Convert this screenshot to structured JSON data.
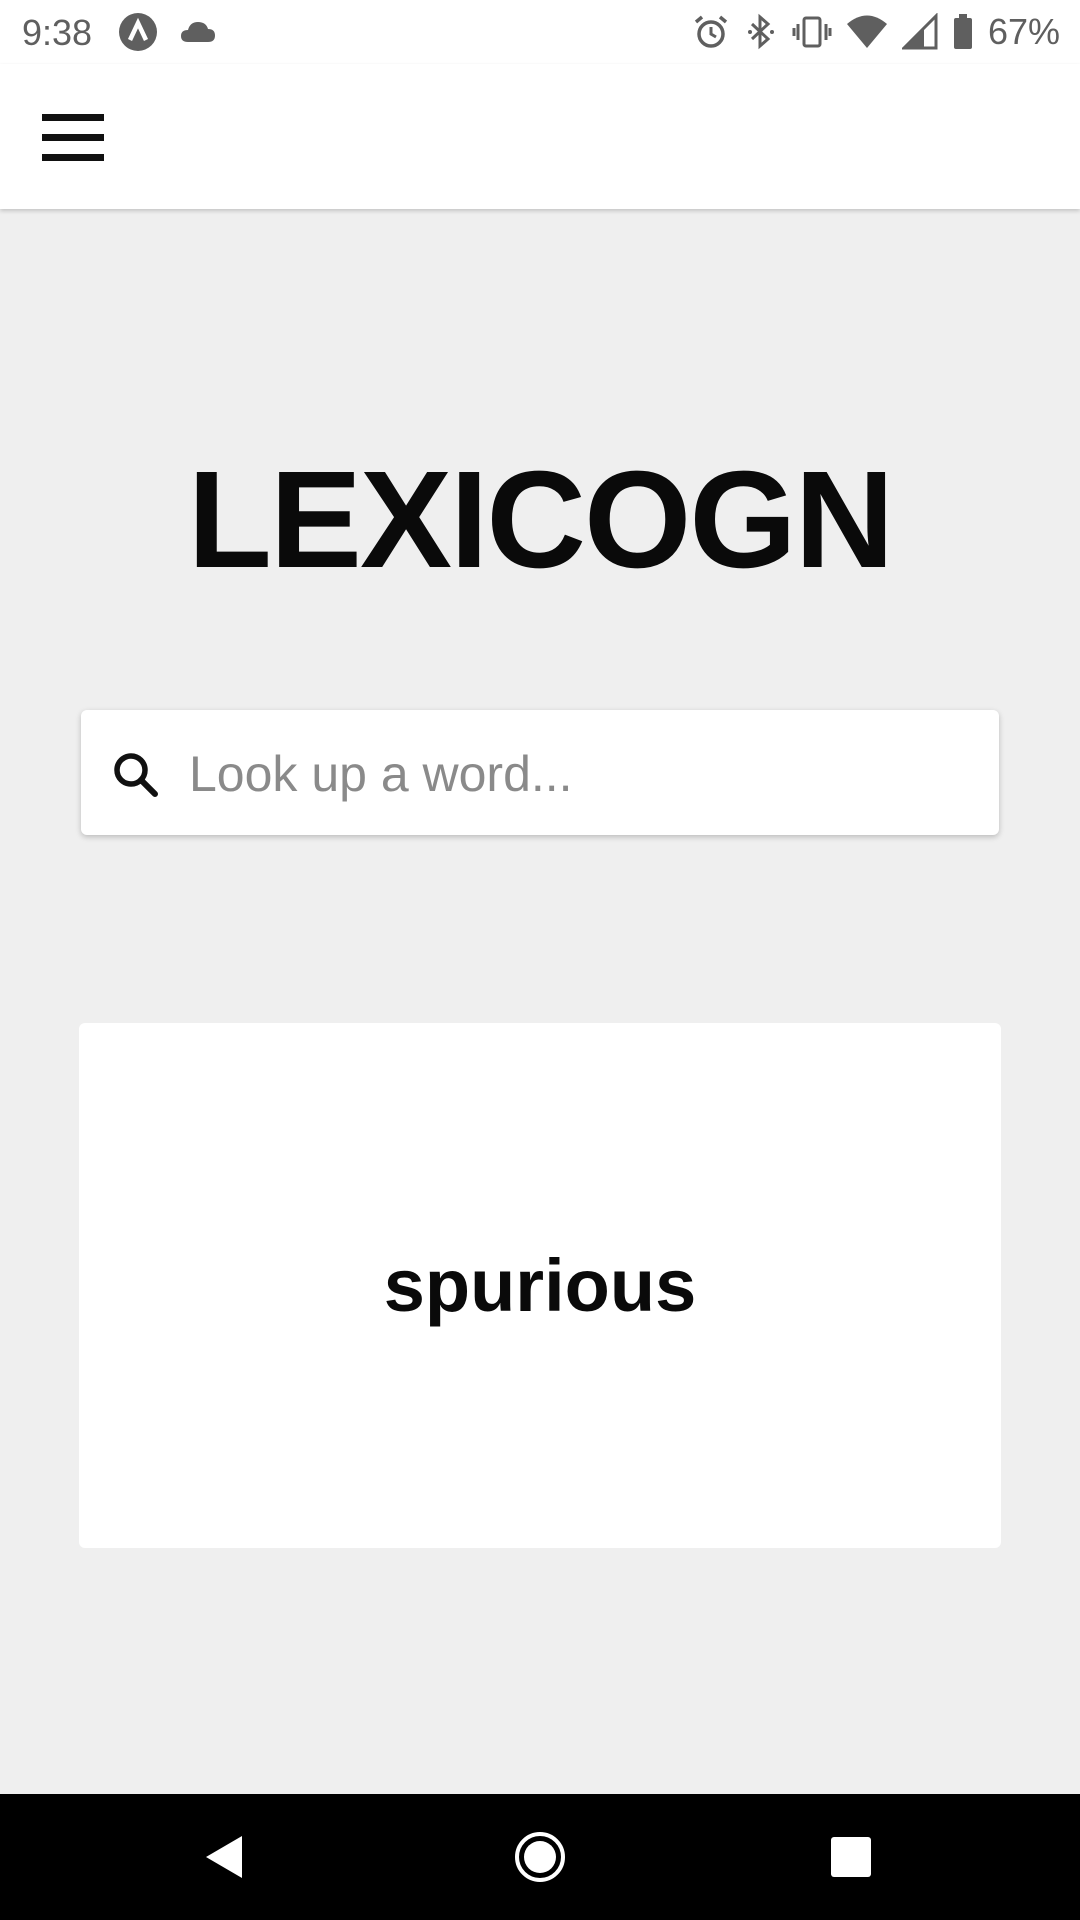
{
  "status_bar": {
    "time": "9:38",
    "battery_percent": "67%",
    "left_icons": [
      "app-notification-icon",
      "cloud-icon"
    ],
    "right_icons": [
      "alarm-icon",
      "bluetooth-icon",
      "vibrate-icon",
      "wifi-icon",
      "signal-icon",
      "battery-icon"
    ]
  },
  "app_bar": {
    "menu_icon": "hamburger-menu-icon"
  },
  "main": {
    "title": "LEXICOGN",
    "search": {
      "placeholder": "Look up a word...",
      "value": "",
      "icon": "search-icon"
    },
    "word_card": {
      "word": "spurious"
    }
  },
  "nav_bar": {
    "buttons": [
      "back-icon",
      "home-icon",
      "recents-icon"
    ]
  },
  "colors": {
    "background": "#efefef",
    "surface": "#ffffff",
    "text_primary": "#0a0a0a",
    "placeholder": "#8a8a8a",
    "status_icons": "#5f5f5f",
    "nav_bar": "#000000"
  }
}
